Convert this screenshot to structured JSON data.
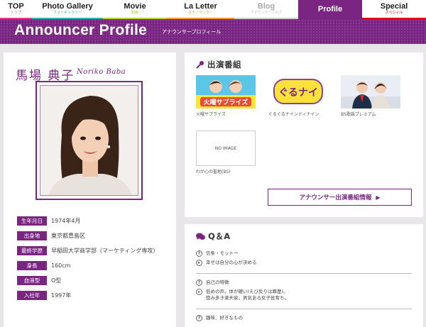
{
  "nav": [
    {
      "main": "TOP",
      "sub": "トップ",
      "sub_color": "#e83f8e",
      "bar": "bar-pink",
      "width": 45
    },
    {
      "main": "Photo Gallery",
      "sub": "フォトギャラリー",
      "sub_color": "#2fb7b8",
      "bar": "bar-teal",
      "width": 100
    },
    {
      "main": "Movie",
      "sub": "動画",
      "sub_color": "#b9d232",
      "bar": "bar-lime",
      "width": 90
    },
    {
      "main": "La Letter",
      "sub": "瓜ナーランター",
      "sub_color": "#f19a32",
      "bar": "bar-orange",
      "width": 95
    },
    {
      "main": "Blog",
      "sub": "アナウンサーブログ",
      "sub_color": "#bbbbbb",
      "bar": "bar-gray",
      "width": 90
    },
    {
      "main": "Profile",
      "sub": "",
      "sub_color": "#ffffff",
      "bar": "",
      "width": 90
    },
    {
      "main": "Special",
      "sub": "スペシャル",
      "sub_color": "#e60012",
      "bar": "bar-red",
      "width": 90
    }
  ],
  "header": {
    "title": "Announcer Profile",
    "sub": "アナウンサープロフィール"
  },
  "profile": {
    "name_jp": "馬場 典子",
    "name_en": "Noriko Baba",
    "info": [
      {
        "label": "生年月日",
        "value": "1974年4月"
      },
      {
        "label": "出身地",
        "value": "東京都豊島区"
      },
      {
        "label": "最終学歴",
        "value": "早稲田大学商学部（マーケティング専攻）"
      },
      {
        "label": "身長",
        "value": "160cm"
      },
      {
        "label": "血液型",
        "value": "O型"
      },
      {
        "label": "入社年",
        "value": "1997年"
      }
    ]
  },
  "programs": {
    "title": "出演番組",
    "items": [
      {
        "caption": "火曜サプライズ",
        "thumb_text": "火曜サプライズ"
      },
      {
        "caption": "ぐるぐるナインティナイン",
        "thumb_text": "ぐるナイ"
      },
      {
        "caption": "BS歌謡プレミアム",
        "thumb_text": ""
      }
    ],
    "noimage_label": "NO IMAGE",
    "noimage_caption": "わが心の聖地(BS)",
    "button_label": "アナウンサー出演番組情報",
    "button_arrow": "▶"
  },
  "qa": {
    "title": "Q＆A",
    "items": [
      {
        "q": "信条・モットー",
        "a": "幸せは自分の心が決める"
      },
      {
        "q": "自己の特徴",
        "a": "低めの声。体が硬い(えび反りは瞬歴)。\n惚み多き楽天家。男気ある女子役育ち。"
      },
      {
        "q": "趣味、好きなもの",
        "a": ""
      }
    ]
  },
  "colors": {
    "accent": "#7a2582",
    "background": "#e9e6e9"
  }
}
